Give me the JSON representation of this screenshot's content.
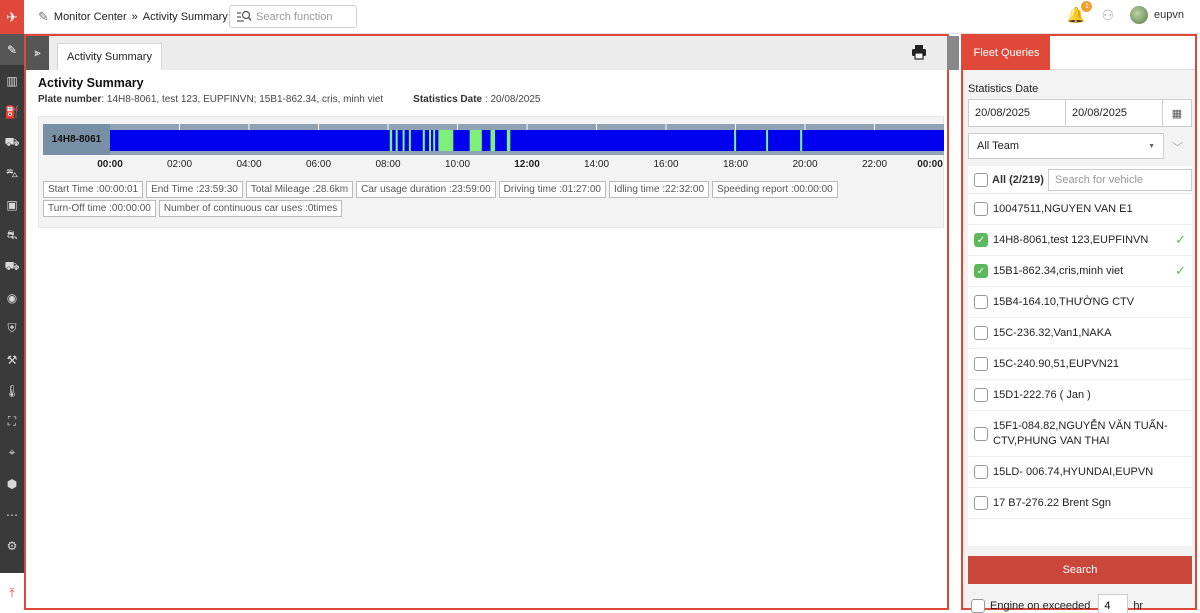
{
  "header": {
    "breadcrumb_root": "Monitor Center",
    "breadcrumb_sep": "»",
    "breadcrumb_current": "Activity Summary",
    "search_placeholder": "Search function",
    "notification_count": "1",
    "username": "eupvn"
  },
  "main": {
    "tab_label": "Activity Summary",
    "title": "Activity Summary",
    "plate_label": "Plate number",
    "plate_value": "14H8-8061, test 123, EUPFINVN; 15B1-862.34, cris, minh viet",
    "stat_date_label": "Statistics Date",
    "stat_date_value": "20/08/2025"
  },
  "chart_data": {
    "type": "timeline",
    "vehicle": "14H8-8061",
    "x_range_hours": [
      0,
      24
    ],
    "ticks": [
      {
        "label": "00:00",
        "hour": 0,
        "bold": true
      },
      {
        "label": "02:00",
        "hour": 2,
        "bold": false
      },
      {
        "label": "04:00",
        "hour": 4,
        "bold": false
      },
      {
        "label": "06:00",
        "hour": 6,
        "bold": false
      },
      {
        "label": "08:00",
        "hour": 8,
        "bold": false
      },
      {
        "label": "10:00",
        "hour": 10,
        "bold": false
      },
      {
        "label": "12:00",
        "hour": 12,
        "bold": true
      },
      {
        "label": "14:00",
        "hour": 14,
        "bold": false
      },
      {
        "label": "16:00",
        "hour": 16,
        "bold": false
      },
      {
        "label": "18:00",
        "hour": 18,
        "bold": false
      },
      {
        "label": "20:00",
        "hour": 20,
        "bold": false
      },
      {
        "label": "22:00",
        "hour": 22,
        "bold": false
      },
      {
        "label": "00:00",
        "hour": 24,
        "bold": true
      }
    ],
    "base_color": "#0000ee",
    "driving_color": "#7ef07a",
    "driving_segments": [
      [
        8.05,
        8.12
      ],
      [
        8.22,
        8.28
      ],
      [
        8.42,
        8.47
      ],
      [
        8.6,
        8.65
      ],
      [
        9.0,
        9.06
      ],
      [
        9.18,
        9.23
      ],
      [
        9.3,
        9.35
      ],
      [
        9.45,
        9.88
      ],
      [
        10.35,
        10.7
      ],
      [
        10.95,
        11.08
      ],
      [
        11.42,
        11.52
      ],
      [
        17.96,
        18.01
      ],
      [
        18.88,
        18.93
      ],
      [
        19.86,
        19.92
      ]
    ]
  },
  "stats": [
    {
      "label": "Start Time",
      "value": "00:00:01"
    },
    {
      "label": "End Time",
      "value": "23:59:30"
    },
    {
      "label": "Total Mileage",
      "value": "28.6km"
    },
    {
      "label": "Car usage duration",
      "value": "23:59:00"
    },
    {
      "label": "Driving time",
      "value": "01:27:00"
    },
    {
      "label": "Idling time",
      "value": "22:32:00"
    },
    {
      "label": "Speeding report",
      "value": "00:00:00"
    },
    {
      "label": "Turn-Off time",
      "value": "00:00:00"
    },
    {
      "label": "Number of continuous car uses",
      "value": "0times"
    }
  ],
  "panel": {
    "tab_label": "Fleet Queries",
    "stat_date_label": "Statistics Date",
    "date_from": "20/08/2025",
    "date_to": "20/08/2025",
    "team_selected": "All Team",
    "all_label": "All (2/219)",
    "vehicle_search_placeholder": "Search for vehicle",
    "vehicles": [
      {
        "label": "10047511,NGUYEN VAN E1",
        "checked": false
      },
      {
        "label": "14H8-8061,test 123,EUPFINVN",
        "checked": true
      },
      {
        "label": "15B1-862.34,cris,minh viet",
        "checked": true
      },
      {
        "label": "15B4-164.10,THƯỜNG CTV",
        "checked": false
      },
      {
        "label": "15C-236.32,Van1,NAKA",
        "checked": false
      },
      {
        "label": "15C-240.90,51,EUPVN21",
        "checked": false
      },
      {
        "label": "15D1-222.76 ( Jan )",
        "checked": false
      },
      {
        "label": "15F1-084.82,NGUYỄN VĂN TUẤN-CTV,PHUNG VAN THAI",
        "checked": false
      },
      {
        "label": "15LD- 006.74,HYUNDAI,EUPVN",
        "checked": false
      },
      {
        "label": "17 B7-276.22 Brent Sgn",
        "checked": false
      }
    ],
    "search_button": "Search",
    "engine_label": "Engine on exceeded",
    "engine_value": "4",
    "engine_unit": "hr"
  }
}
